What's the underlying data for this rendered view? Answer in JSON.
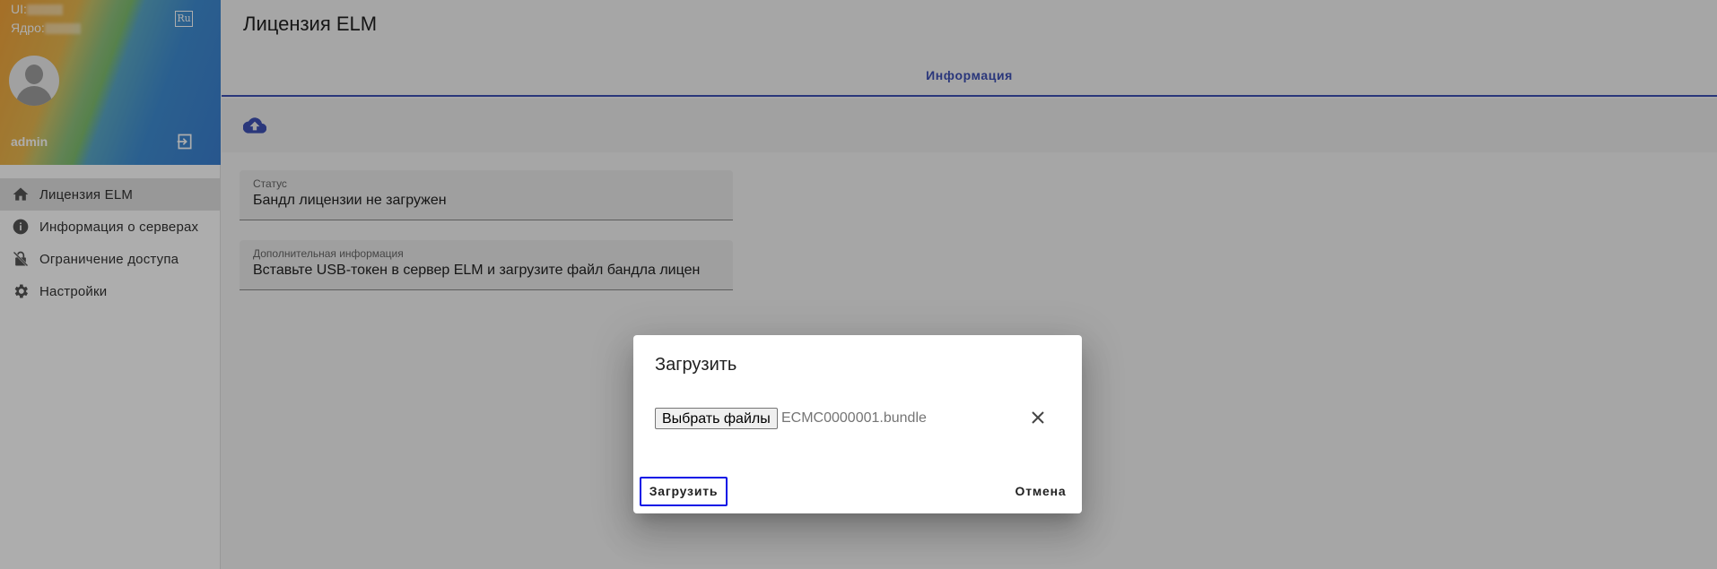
{
  "sidebar": {
    "ui_label": "UI:",
    "core_label": "Ядро:",
    "lang_label": "Ru",
    "user_name": "admin",
    "items": [
      {
        "label": "Лицензия ELM",
        "icon": "home-icon"
      },
      {
        "label": "Информация о серверах",
        "icon": "info-icon"
      },
      {
        "label": "Ограничение доступа",
        "icon": "lock-off-icon"
      },
      {
        "label": "Настройки",
        "icon": "gear-icon"
      }
    ]
  },
  "main": {
    "title": "Лицензия ELM",
    "tab_label": "Информация",
    "status": {
      "label": "Статус",
      "value": "Бандл лицензии не загружен"
    },
    "extra": {
      "label": "Дополнительная информация",
      "value": "Вставьте USB-токен в сервер ELM и загрузите файл бандла лицен"
    }
  },
  "dialog": {
    "title": "Загрузить",
    "choose_files_label": "Выбрать файлы",
    "file_name": "ECMC0000001.bundle",
    "upload_label": "Загрузить",
    "cancel_label": "Отмена"
  },
  "colors": {
    "accent": "#3f51b5",
    "focus_outline": "#0a14e6"
  }
}
